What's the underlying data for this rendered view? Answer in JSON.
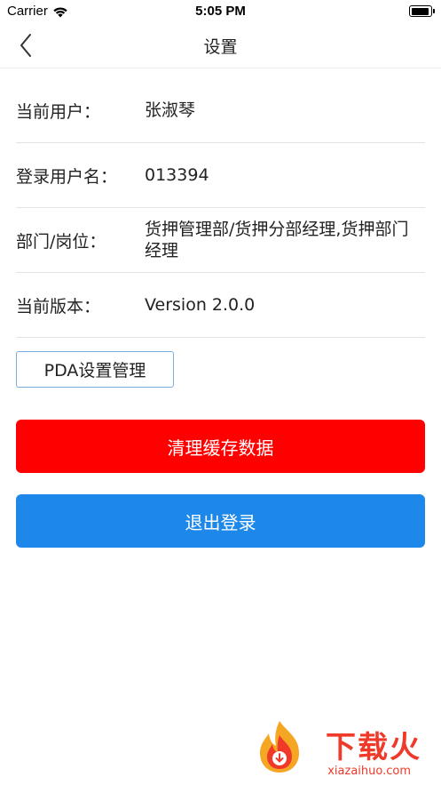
{
  "status_bar": {
    "carrier": "Carrier",
    "time": "5:05 PM"
  },
  "nav": {
    "title": "设置",
    "back_icon": "chevron-left-icon"
  },
  "info": [
    {
      "label": "当前用户：",
      "value": "张淑琴"
    },
    {
      "label": "登录用户名：",
      "value": "013394"
    },
    {
      "label": "部门/岗位：",
      "value": "货押管理部/货押分部经理,货押部门经理"
    },
    {
      "label": "当前版本：",
      "value": "Version 2.0.0"
    }
  ],
  "buttons": {
    "pda": "PDA设置管理",
    "clear_cache": "清理缓存数据",
    "logout": "退出登录"
  },
  "colors": {
    "clear_cache": "#fe0000",
    "logout": "#1e88ea",
    "pda_border": "#7aaedc"
  },
  "watermark": {
    "text": "下载火",
    "url": "xiazaihuo.com"
  }
}
